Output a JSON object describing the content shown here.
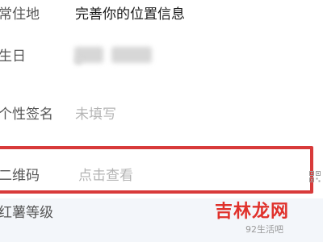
{
  "profile": {
    "rows": [
      {
        "label": "常住地",
        "value": "完善你的位置信息"
      },
      {
        "label": "生日",
        "value": ""
      },
      {
        "label": "个性签名",
        "value": "未填写"
      },
      {
        "label": "二维码",
        "value": "点击查看"
      },
      {
        "label": "红薯等级",
        "value": ""
      }
    ]
  },
  "icons": {
    "qr": "qr-code-icon"
  },
  "colors": {
    "highlight": "#d83a3a",
    "watermark": "#e0312b"
  },
  "watermark": {
    "logo_text": "吉林龙网",
    "url": "92生活吧"
  }
}
